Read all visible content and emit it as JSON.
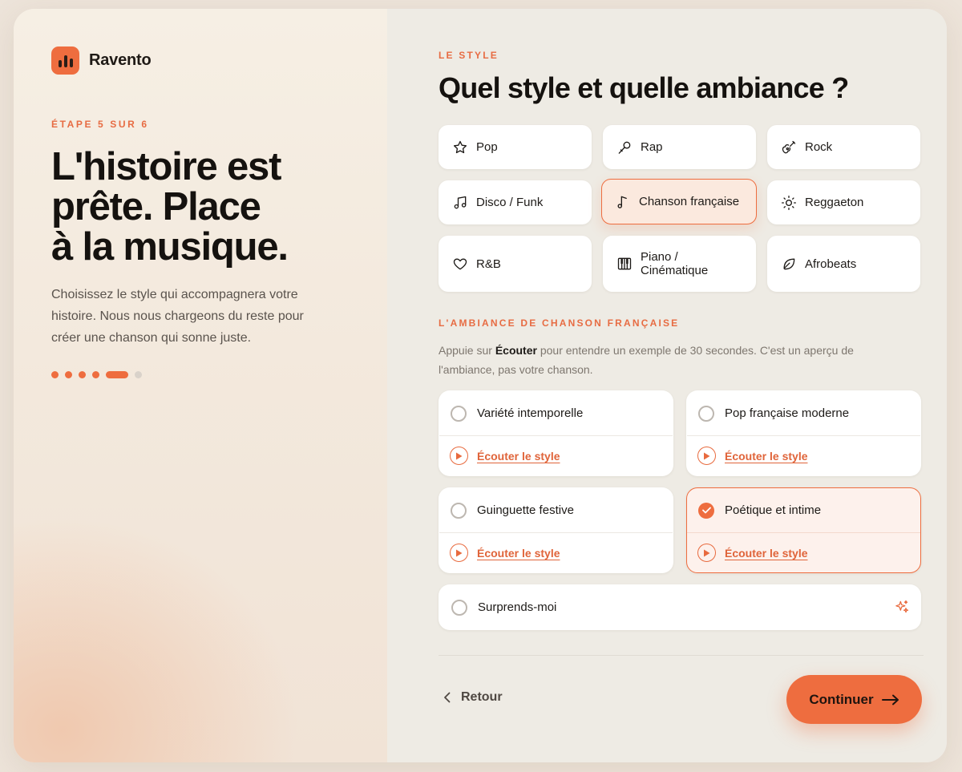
{
  "brand": {
    "name": "Ravento"
  },
  "intro": {
    "step": "ÉTAPE 5 SUR 6",
    "headline": [
      "L'histoire est",
      "prête. Place",
      "à la musique."
    ],
    "description": "Choisissez le style qui accompagnera votre histoire. Nous nous chargeons du reste pour créer une chanson qui sonne juste.",
    "progress": {
      "current": 5,
      "total": 6
    }
  },
  "style": {
    "section_label": "LE STYLE",
    "title": "Quel style et quelle ambiance ?",
    "genres": [
      {
        "label": "Pop",
        "icon": "star-icon",
        "selected": false
      },
      {
        "label": "Rap",
        "icon": "microphone-icon",
        "selected": false
      },
      {
        "label": "Rock",
        "icon": "guitar-icon",
        "selected": false
      },
      {
        "label": "Disco / Funk",
        "icon": "music-notes-icon",
        "selected": false
      },
      {
        "label": "Chanson française",
        "icon": "music-note-icon",
        "selected": true
      },
      {
        "label": "Reggaeton",
        "icon": "sun-icon",
        "selected": false
      },
      {
        "label": "R&B",
        "icon": "heart-icon",
        "selected": false
      },
      {
        "label": "Piano / Cinématique",
        "icon": "piano-icon",
        "selected": false
      },
      {
        "label": "Afrobeats",
        "icon": "leaf-icon",
        "selected": false
      }
    ]
  },
  "ambiance": {
    "section_label": "L'AMBIANCE DE CHANSON FRANÇAISE",
    "hint_prefix": "Appuie sur ",
    "hint_bold": "Écouter",
    "hint_suffix": " pour entendre un exemple de 30 secondes. C'est un aperçu de l'ambiance, pas votre chanson.",
    "listen_label": "Écouter le style",
    "options": [
      {
        "name": "Variété intemporelle",
        "selected": false
      },
      {
        "name": "Pop française moderne",
        "selected": false
      },
      {
        "name": "Guinguette festive",
        "selected": false
      },
      {
        "name": "Poétique et intime",
        "selected": true
      }
    ],
    "surprise": {
      "name": "Surprends-moi",
      "icon": "sparkle-icon"
    }
  },
  "nav": {
    "back_label": "Retour",
    "continue_label": "Continuer"
  },
  "colors": {
    "accent": "#ee6d3f",
    "accent_text": "#e76c43",
    "ink": "#15120f"
  }
}
